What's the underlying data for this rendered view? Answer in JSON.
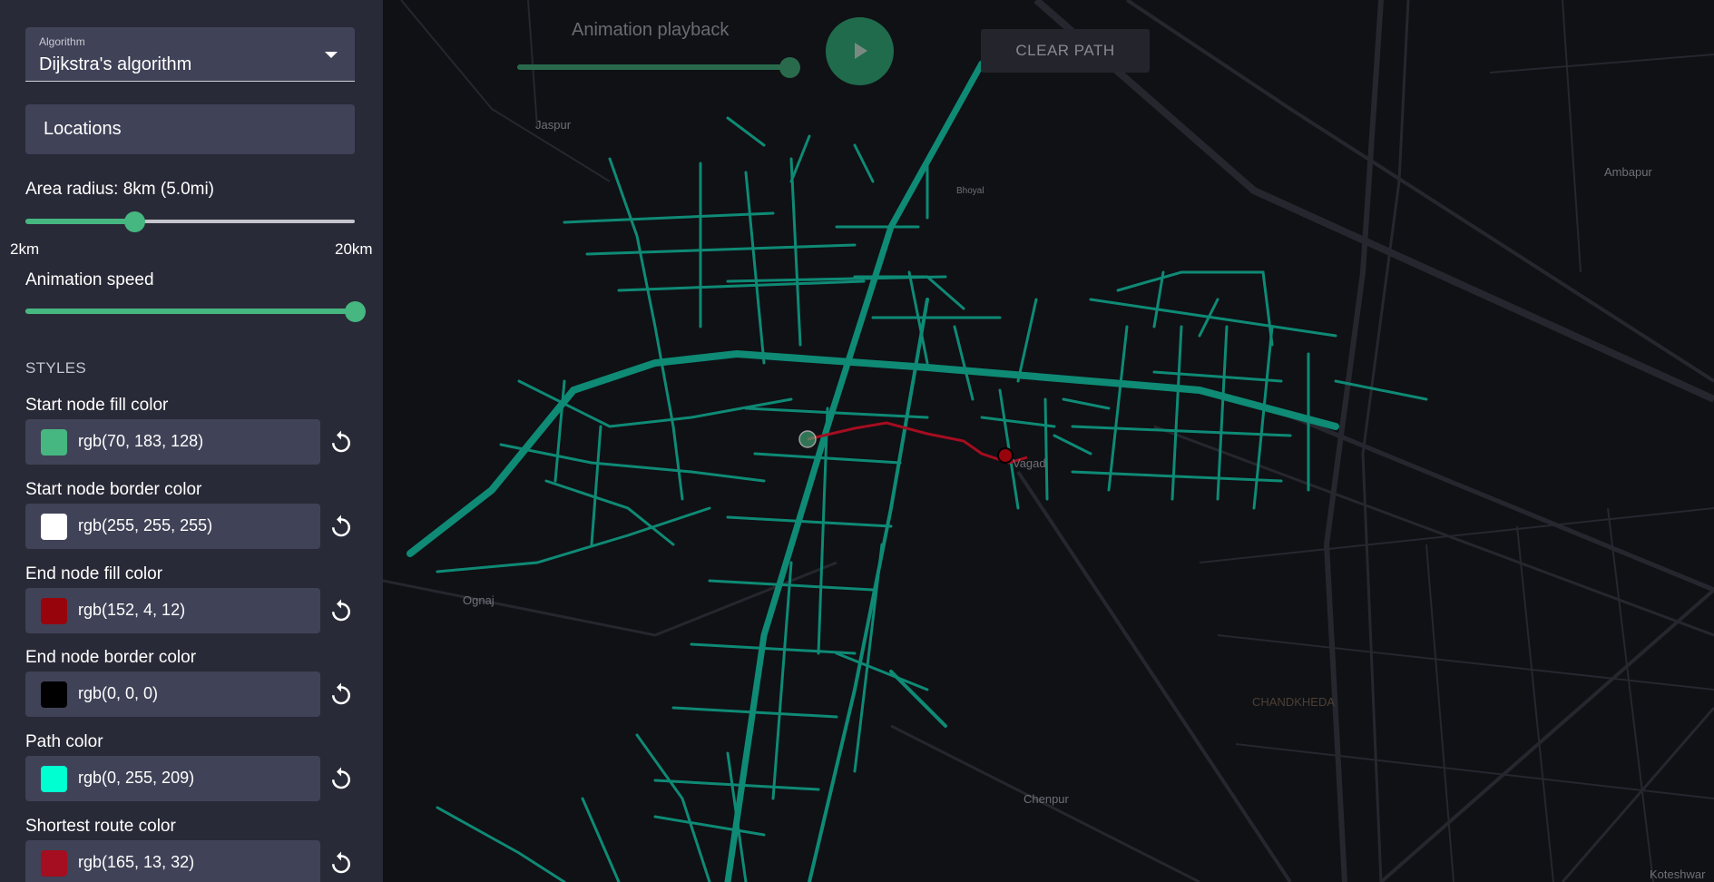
{
  "sidebar": {
    "algorithm": {
      "label": "Algorithm",
      "value": "Dijkstra's algorithm"
    },
    "locations_label": "Locations",
    "area_radius": {
      "label": "Area radius: 8km (5.0mi)",
      "min_label": "2km",
      "max_label": "20km",
      "value_fraction": 0.33
    },
    "animation_speed": {
      "label": "Animation speed",
      "value_fraction": 1.0
    },
    "styles_title": "STYLES",
    "styles": [
      {
        "label": "Start node fill color",
        "value": "rgb(70, 183, 128)",
        "color": "#46b780"
      },
      {
        "label": "Start node border color",
        "value": "rgb(255, 255, 255)",
        "color": "#ffffff"
      },
      {
        "label": "End node fill color",
        "value": "rgb(152, 4, 12)",
        "color": "#98040c"
      },
      {
        "label": "End node border color",
        "value": "rgb(0, 0, 0)",
        "color": "#000000"
      },
      {
        "label": "Path color",
        "value": "rgb(0, 255, 209)",
        "color": "#00ffd1"
      },
      {
        "label": "Shortest route color",
        "value": "rgb(165, 13, 32)",
        "color": "#a50d20"
      }
    ]
  },
  "toolbar": {
    "playback_label": "Animation playback",
    "playback_fraction": 1.0,
    "clear_label": "CLEAR PATH"
  },
  "map": {
    "places": [
      "Jaspur",
      "Ambapur",
      "Ognaj",
      "Chenpur",
      "CHANDKHEDA",
      "Koteshwar",
      "Bhoyal",
      "Vagad"
    ],
    "colors": {
      "network": "#0e8a75",
      "background": "#0f1115",
      "roads": "#26272e",
      "start_node": "#46b780",
      "end_node": "#98040c",
      "route": "#a50d20"
    }
  }
}
